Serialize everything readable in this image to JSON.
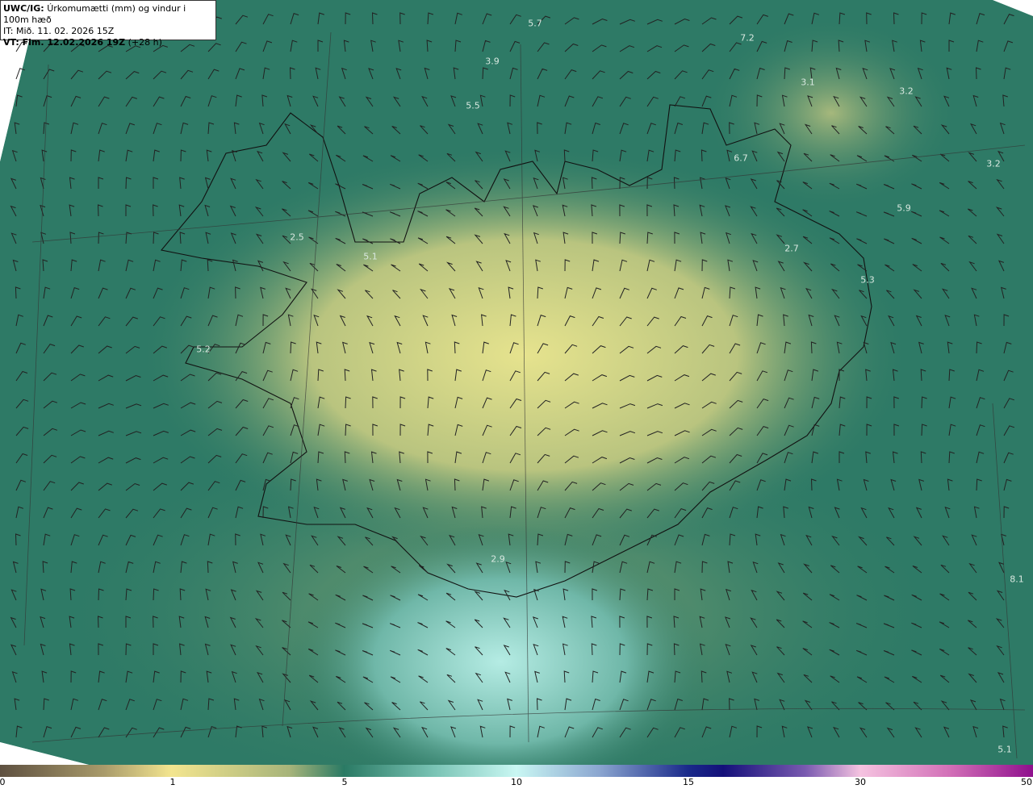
{
  "header": {
    "model_label": "UWC/IG:",
    "title": "Úrkomumætti (mm) og vindur i 100m hæð",
    "initial_time": "IT: Mið. 11. 02. 2026 15Z",
    "valid_label": "VT: Fim. 12.02.2026 19Z",
    "lead_time": "(+28 h)"
  },
  "colorbar": {
    "ticks": [
      "0",
      "1",
      "5",
      "10",
      "15",
      "30",
      "50"
    ],
    "colors": [
      "#5e5040",
      "#f3e58f",
      "#2a7a64",
      "#c9f7f3",
      "#14107a",
      "#f5c3e0",
      "#8f108d"
    ]
  },
  "map_values": [
    "5.7",
    "7.2",
    "3.9",
    "5.5",
    "3.1",
    "3.2",
    "6.7",
    "3.2",
    "5.9",
    "2.7",
    "5.3",
    "5.1",
    "2.5",
    "5.2",
    "2.9",
    "8.1",
    "5.1"
  ],
  "colors": {
    "background_field": "#2e7a66",
    "land_max": "#e6e38e",
    "sea_south": "#8fd0c4",
    "coastline": "#111111"
  }
}
